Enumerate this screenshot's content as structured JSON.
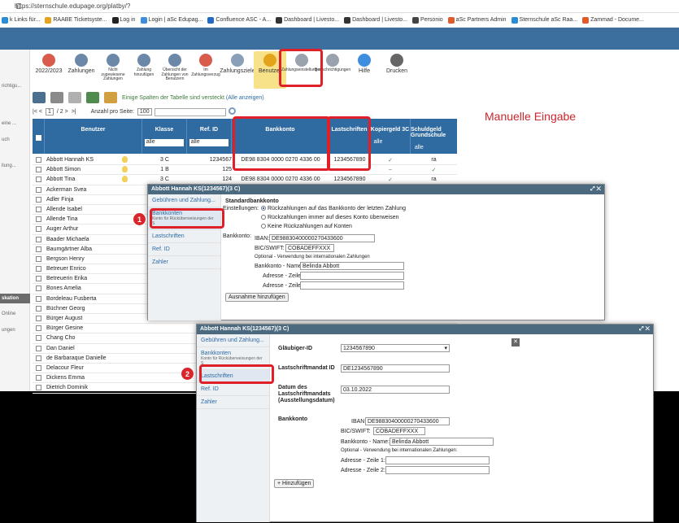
{
  "browser": {
    "url": "https://sternschule.edupage.org/platby/?",
    "bookmarks": [
      {
        "label": "k Links für...",
        "color": "#2a8cd6"
      },
      {
        "label": "RAABE Ticketsyste...",
        "color": "#e3a31b"
      },
      {
        "label": "Log in",
        "color": "#222222"
      },
      {
        "label": "Login | aSc Edupag...",
        "color": "#3e8ee0"
      },
      {
        "label": "Confluence ASC - A...",
        "color": "#2468c8"
      },
      {
        "label": "Dashboard | Livesto...",
        "color": "#333333"
      },
      {
        "label": "Dashboard | Livesto...",
        "color": "#333333"
      },
      {
        "label": "Personio",
        "color": "#444444"
      },
      {
        "label": "aSc Partners Admin",
        "color": "#e05a2b"
      },
      {
        "label": "Sternschule aSc Raa...",
        "color": "#2a8cd6"
      },
      {
        "label": "Zammad - Docume...",
        "color": "#e05a2b"
      }
    ]
  },
  "leftnav": {
    "items": [
      "richtigu...",
      "eine ...",
      "uch",
      "llung...",
      "",
      "",
      "",
      "",
      "skation",
      "Online",
      "ungen"
    ]
  },
  "toolbar": {
    "items": [
      {
        "label": "2022/2023",
        "icon": "calendar-icon",
        "color": "#d95b4b"
      },
      {
        "label": "Zahlungen",
        "icon": "money-bag-icon",
        "color": "#6b88a8"
      },
      {
        "label": "Nicht zugewiesene Zahlungen",
        "icon": "question-bag-icon",
        "color": "#6b88a8"
      },
      {
        "label": "Zahlung hinzufügen",
        "icon": "add-payment-icon",
        "color": "#6b88a8"
      },
      {
        "label": "Übersicht der Zahlungen von Benutzern",
        "icon": "overview-icon",
        "color": "#6b88a8"
      },
      {
        "label": "Im Zahlungsverzug",
        "icon": "overdue-icon",
        "color": "#d95b4b"
      },
      {
        "label": "Zahlungsziele",
        "icon": "target-icon",
        "color": "#8aa0b8"
      },
      {
        "label": "Benutzer",
        "icon": "user-icon",
        "color": "#e3a31b"
      },
      {
        "label": "Zahlungseinstellungen",
        "icon": "settings-icon",
        "color": "#9aa3ad"
      },
      {
        "label": "Benachrichtigungen",
        "icon": "notification-icon",
        "color": "#9aa3ad"
      },
      {
        "label": "Hilfe",
        "icon": "help-icon",
        "color": "#3e8ee0"
      },
      {
        "label": "Drucken",
        "icon": "print-icon",
        "color": "#666666"
      }
    ]
  },
  "hint": {
    "text": "Einige Spalten der Tabelle sind versteckt",
    "link": "(Alle anzeigen)"
  },
  "pager": {
    "prev": "|< <",
    "page": "1",
    "of": "/ 2 >",
    "next": ">|",
    "per_page_label": "Anzahl pro Seite:",
    "per_page": "100"
  },
  "annotation": "Manuelle Eingabe",
  "table": {
    "headers": {
      "user": "Benutzer",
      "class": "Klasse",
      "ref": "Ref. ID",
      "bank": "Bankkonto",
      "debit": "Lastschriften",
      "copy": "Kopiergeld 3C",
      "debt": "Schuldgeld Grundschule"
    },
    "filter_all": "alle",
    "rows": [
      {
        "name": "Abbott Hannah KS",
        "class": "3 C",
        "ref": "1234567",
        "bank": "DE98 8304 0000 0270 4336 00",
        "debit": "1234567890",
        "copy": "✓",
        "debt": "ra"
      },
      {
        "name": "Abbott Simon",
        "class": "1 B",
        "ref": "125",
        "bank": "",
        "debit": "",
        "copy": "–",
        "debt": "✓"
      },
      {
        "name": "Abbott Tina",
        "class": "3 C",
        "ref": "124",
        "bank": "DE98 8304 0000 0270 4336 00",
        "debit": "1234567890",
        "copy": "✓",
        "debt": "ra"
      },
      {
        "name": "Ackerman Svea"
      },
      {
        "name": "Adler Finja"
      },
      {
        "name": "Allende Isabel"
      },
      {
        "name": "Allende Tina"
      },
      {
        "name": "Auger Arthur"
      },
      {
        "name": "Baader Michaela"
      },
      {
        "name": "Baumgärtner Alba"
      },
      {
        "name": "Bergson Henry"
      },
      {
        "name": "Betreuer Enrico"
      },
      {
        "name": "Betreuerin Erika"
      },
      {
        "name": "Bones Amelia"
      },
      {
        "name": "Bordeleau Fusberta"
      },
      {
        "name": "Büchner Georg"
      },
      {
        "name": "Bürger August"
      },
      {
        "name": "Bürger Gesine"
      },
      {
        "name": "Chang Cho"
      },
      {
        "name": "Dan Daniel"
      },
      {
        "name": "de Barbaraque Danielle"
      },
      {
        "name": "Delacour Fleur"
      },
      {
        "name": "Dickens Emma"
      },
      {
        "name": "Dietrich Dominik"
      }
    ]
  },
  "dialog1": {
    "title": "Abbott Hannah KS(1234567)(3 C)",
    "side": [
      {
        "label": "Gebühren und Zahlung..."
      },
      {
        "label": "Bankkonten",
        "sub": "Konto für Rücküberweisungen der S"
      },
      {
        "label": "Lastschriften"
      },
      {
        "label": "Ref. ID"
      },
      {
        "label": "Zahler"
      }
    ],
    "heading": "Standardbankkonto",
    "settings_label": "Einstellungen:",
    "radios": [
      "Rückzahlungen auf das Bankkonto der letzten Zahlung",
      "Rückzahlungen immer auf dieses Konto überweisen",
      "Keine Rückzahlungen auf Konten"
    ],
    "account_label": "Bankkonto:",
    "iban_label": "IBAN:",
    "iban": "DE98830400000270433600",
    "bic_label": "BIC/SWIFT:",
    "bic": "COBADEFFXXX",
    "optional": "Optional - Verwendung bei internationalen Zahlungen",
    "name_label": "Bankkonto - Name:",
    "name": "Belinda Abbott",
    "addr1_label": "Adresse - Zeile 1:",
    "addr2_label": "Adresse - Zeile 2:",
    "exception_btn": "Ausnahme hinzufügen"
  },
  "dialog2": {
    "title": "Abbott Hannah KS(1234567)(3 C)",
    "side": [
      {
        "label": "Gebühren und Zahlung..."
      },
      {
        "label": "Bankkonten",
        "sub": "Konto für Rücküberweisungen der S"
      },
      {
        "label": "Lastschriften"
      },
      {
        "label": "Ref. ID"
      },
      {
        "label": "Zahler"
      }
    ],
    "creditor_label": "Gläubiger-ID",
    "creditor": "1234567890",
    "mandate_label": "Lastschriftmandat ID",
    "mandate": "DE1234567890",
    "date_label": "Datum des Lastschriftmandats (Ausstellungsdatum)",
    "date": "03.10.2022",
    "account_label": "Bankkonto",
    "iban_label": "IBAN:",
    "iban": "DE98830400000270433600",
    "bic_label": "BIC/SWIFT:",
    "bic": "COBADEFFXXX",
    "name_label": "Bankkonto - Name:",
    "name": "Belinda Abbott",
    "optional": "Optional - Verwendung bei internationalen Zahlungen:",
    "addr1_label": "Adresse - Zeile 1:",
    "addr2_label": "Adresse - Zeile 2:",
    "add_btn": "+ Hinzufügen",
    "close": "✕"
  },
  "badges": {
    "one": "1",
    "two": "2"
  },
  "colors": {
    "header": "#3d6f9e",
    "table_header": "#2f6aa0",
    "highlight": "#e02029",
    "dialog_title": "#4b6a80"
  }
}
